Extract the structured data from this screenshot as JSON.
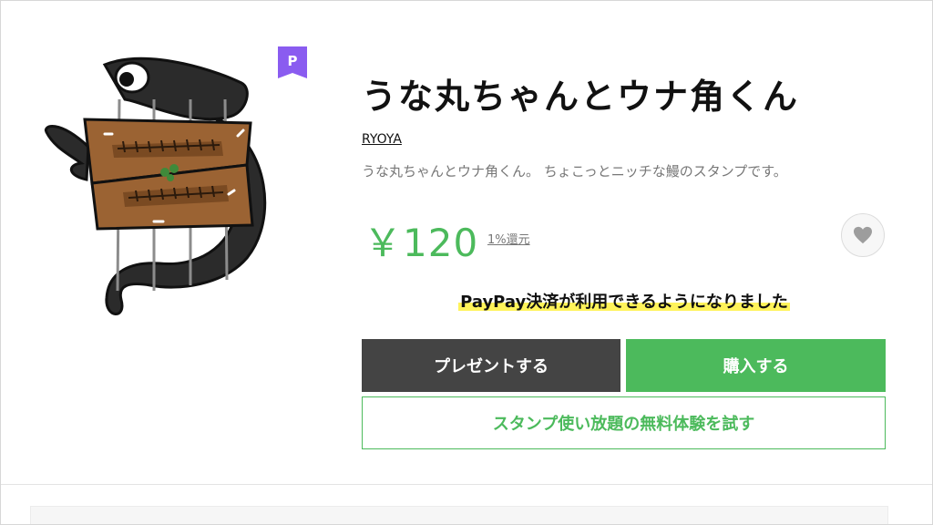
{
  "product": {
    "title": "うな丸ちゃんとウナ角くん",
    "author": "RYOYA",
    "description": "うな丸ちゃんとウナ角くん。 ちょこっとニッチな鰻のスタンプです。",
    "price": "￥120",
    "point_back": "1%還元",
    "premium_badge": "P",
    "sticker_icon": "eel-sticker-image"
  },
  "notice": {
    "paypay": "PayPay決済が利用できるようになりました"
  },
  "actions": {
    "gift_label": "プレゼントする",
    "buy_label": "購入する",
    "premium_label": "スタンプ使い放題の無料体験を試す",
    "favorite_icon": "heart-icon"
  },
  "colors": {
    "accent_green": "#4cba5c",
    "gift_button": "#444444",
    "premium_badge": "#8a5cf0",
    "highlight_yellow": "#fff35a"
  }
}
